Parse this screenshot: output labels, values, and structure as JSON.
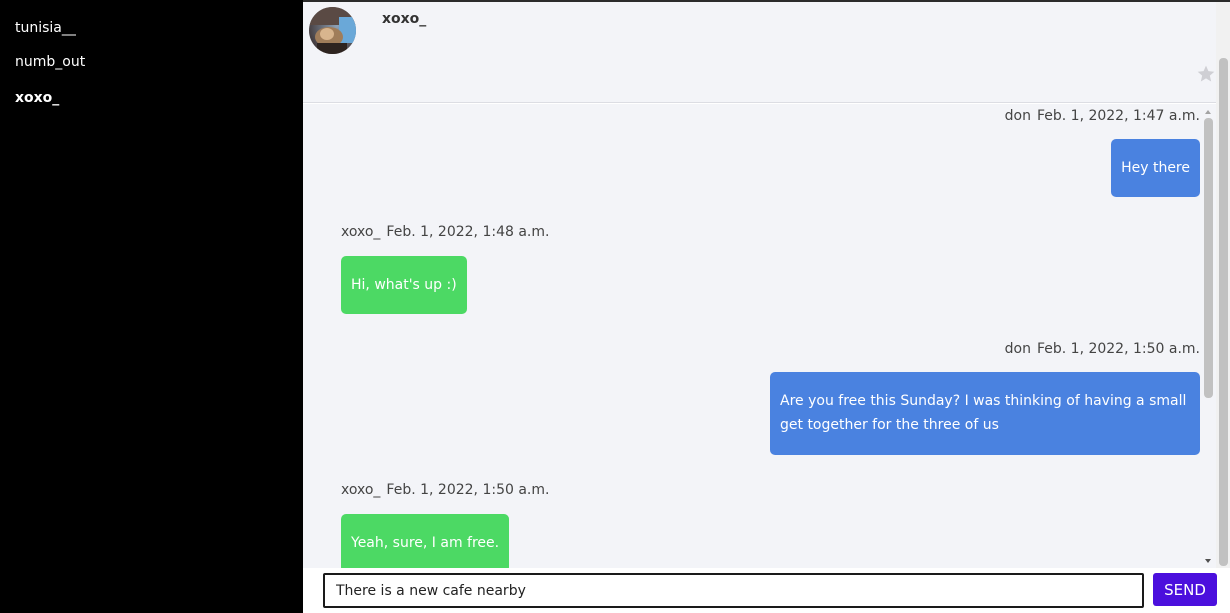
{
  "sidebar": {
    "contacts": [
      {
        "label": "tunisia__"
      },
      {
        "label": "numb_out"
      },
      {
        "label": "xoxo_"
      }
    ]
  },
  "header": {
    "name": "xoxo_",
    "avatar_icon": "profile-photo",
    "star_icon": "star-icon"
  },
  "messages": [
    {
      "sender": "don",
      "time": "Feb. 1, 2022, 1:47 a.m.",
      "text": "Hey there",
      "own": true
    },
    {
      "sender": "xoxo_",
      "time": "Feb. 1, 2022, 1:48 a.m.",
      "text": "Hi, what's up :)",
      "own": false
    },
    {
      "sender": "don",
      "time": "Feb. 1, 2022, 1:50 a.m.",
      "text": "Are you free this Sunday? I was thinking of having a small get together for the three of us",
      "own": true
    },
    {
      "sender": "xoxo_",
      "time": "Feb. 1, 2022, 1:50 a.m.",
      "text": "Yeah, sure, I am free.",
      "own": false
    }
  ],
  "composer": {
    "value": "There is a new cafe nearby",
    "send_label": "SEND"
  },
  "colors": {
    "sidebar_bg": "#000000",
    "own_bubble": "#4a82e0",
    "other_bubble": "#4cd964",
    "send_button": "#4b0fdd",
    "chat_bg": "#f3f4f8"
  }
}
